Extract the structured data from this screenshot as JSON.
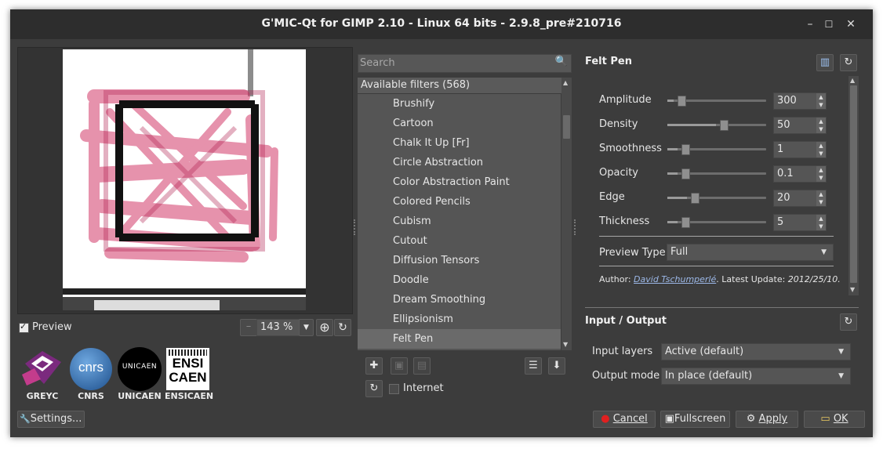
{
  "window": {
    "title": "G'MIC-Qt for GIMP 2.10 - Linux 64 bits - 2.9.8_pre#210716",
    "controls": {
      "minimize": "–",
      "maximize": "☐",
      "close": "✕"
    }
  },
  "preview": {
    "checkbox_label": "Preview",
    "checked": true,
    "zoom_value": "143 %"
  },
  "logos": [
    {
      "name": "GREYC"
    },
    {
      "name": "CNRS"
    },
    {
      "name": "UNICAEN"
    },
    {
      "name": "ENSICAEN"
    }
  ],
  "logo_texts": {
    "cnrs": "cnrs",
    "unicaen": "UNICAEN",
    "ensi_top": "ENSI",
    "ensi_bottom": "CAEN"
  },
  "settings_label": "Settings...",
  "filters": {
    "search_placeholder": "Search",
    "header": "Available filters (568)",
    "items": [
      "Brushify",
      "Cartoon",
      "Chalk It Up [Fr]",
      "Circle Abstraction",
      "Color Abstraction Paint",
      "Colored Pencils",
      "Cubism",
      "Cutout",
      "Diffusion Tensors",
      "Doodle",
      "Dream Smoothing",
      "Ellipsionism",
      "Felt Pen"
    ],
    "selected": "Felt Pen",
    "internet_label": "Internet"
  },
  "params": {
    "title": "Felt Pen",
    "items": [
      {
        "label": "Amplitude",
        "value": "300",
        "fraction": 0.06
      },
      {
        "label": "Density",
        "value": "50",
        "fraction": 0.49
      },
      {
        "label": "Smoothness",
        "value": "1",
        "fraction": 0.1
      },
      {
        "label": "Opacity",
        "value": "0.1",
        "fraction": 0.1
      },
      {
        "label": "Edge",
        "value": "20",
        "fraction": 0.2
      },
      {
        "label": "Thickness",
        "value": "5",
        "fraction": 0.1
      }
    ],
    "preview_type_label": "Preview Type",
    "preview_type_value": "Full",
    "author_prefix": "Author: ",
    "author_name": "David Tschumperlé",
    "update_text": ".    Latest Update: ",
    "update_date": "2012/25/10."
  },
  "io": {
    "title": "Input / Output",
    "input_layers_label": "Input layers",
    "input_layers_value": "Active (default)",
    "output_mode_label": "Output mode",
    "output_mode_value": "In place (default)"
  },
  "buttons": {
    "cancel": "Cancel",
    "fullscreen": "Fullscreen",
    "apply": "Apply",
    "ok": "OK"
  }
}
